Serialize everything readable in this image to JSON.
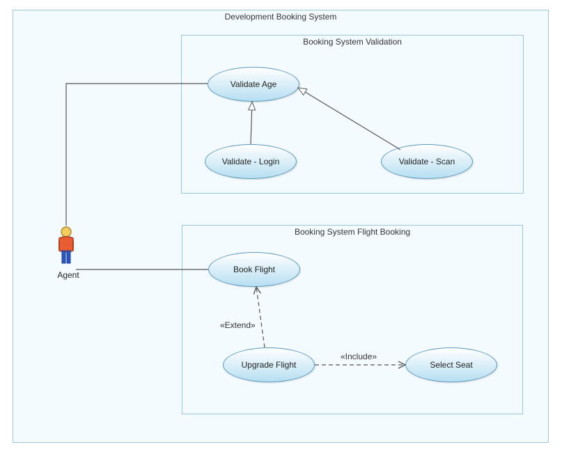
{
  "system": {
    "title": "Development Booking System"
  },
  "validation": {
    "title": "Booking System Validation",
    "validate_age": "Validate Age",
    "validate_login": "Validate - Login",
    "validate_scan": "Validate - Scan"
  },
  "flight": {
    "title": "Booking System Flight Booking",
    "book_flight": "Book Flight",
    "upgrade_flight": "Upgrade Flight",
    "select_seat": "Select Seat"
  },
  "actor": {
    "name": "Agent"
  },
  "relations": {
    "extend": "«Extend»",
    "include": "«Include»"
  },
  "chart_data": {
    "type": "diagram",
    "diagram_type": "uml_use_case",
    "system_boundary": "Development Booking System",
    "actors": [
      "Agent"
    ],
    "subsystems": [
      {
        "name": "Booking System Validation",
        "use_cases": [
          "Validate Age",
          "Validate - Login",
          "Validate - Scan"
        ]
      },
      {
        "name": "Booking System Flight Booking",
        "use_cases": [
          "Book Flight",
          "Upgrade Flight",
          "Select Seat"
        ]
      }
    ],
    "relationships": [
      {
        "from": "Agent",
        "to": "Validate Age",
        "type": "association"
      },
      {
        "from": "Agent",
        "to": "Book Flight",
        "type": "association"
      },
      {
        "from": "Validate - Login",
        "to": "Validate Age",
        "type": "generalization"
      },
      {
        "from": "Validate - Scan",
        "to": "Validate Age",
        "type": "generalization"
      },
      {
        "from": "Upgrade Flight",
        "to": "Book Flight",
        "type": "extend"
      },
      {
        "from": "Upgrade Flight",
        "to": "Select Seat",
        "type": "include"
      }
    ]
  }
}
